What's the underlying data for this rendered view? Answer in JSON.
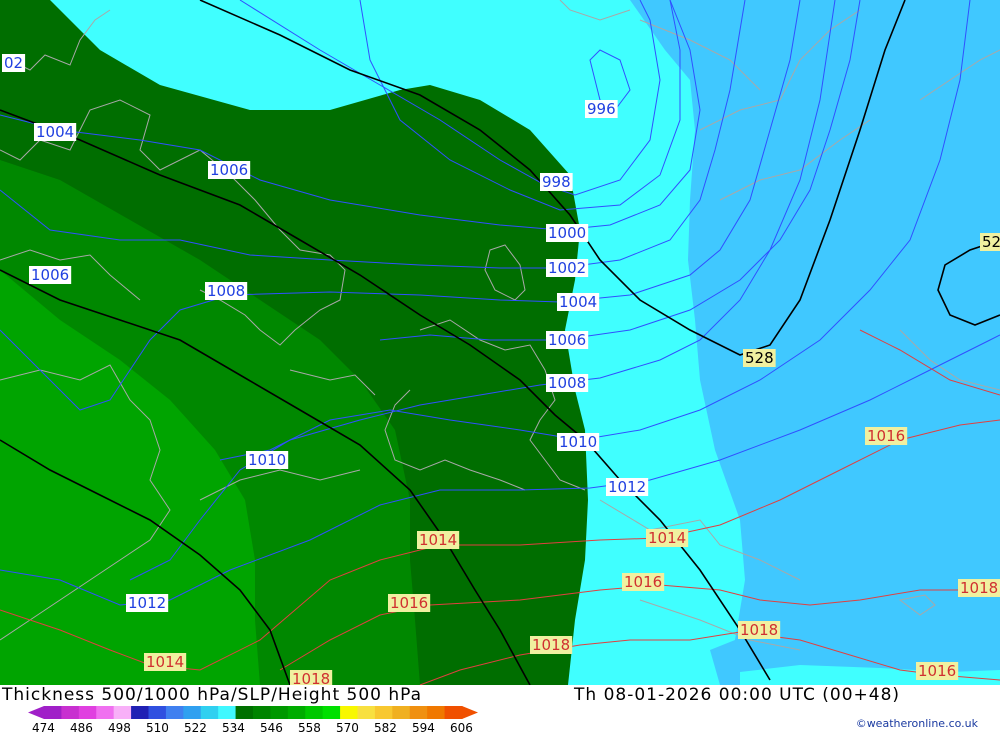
{
  "header": {
    "title": "Thickness 500/1000 hPa/SLP/Height 500 hPa",
    "datetime": "Th 08-01-2026 00:00 UTC (00+48)",
    "credit": "©weatheronline.co.uk"
  },
  "legend": {
    "ticks": [
      "474",
      "486",
      "498",
      "510",
      "522",
      "534",
      "546",
      "558",
      "570",
      "582",
      "594",
      "606"
    ],
    "colors": [
      "#a020c8",
      "#c830d0",
      "#e040e0",
      "#f070f0",
      "#f8b0f8",
      "#2020b4",
      "#3050e0",
      "#4080f0",
      "#30a0f0",
      "#30d0f0",
      "#40f8ff",
      "#007000",
      "#008400",
      "#009800",
      "#00ac00",
      "#00c800",
      "#00e000",
      "#f8f800",
      "#f8e040",
      "#f8c830",
      "#f0b020",
      "#f09010",
      "#f07800",
      "#f05000"
    ]
  },
  "map": {
    "colors": {
      "light_cyan": "#40ffff",
      "sky_blue": "#40c8ff",
      "dark_green": "#006e00",
      "mid_green": "#008800",
      "light_green": "#00a400",
      "bright_green": "#00b400",
      "isobar_blue": "#3050ff",
      "isobar_red": "#e04040",
      "height_black": "#000000",
      "coast_grey": "#a8a8a8"
    },
    "isobar_labels": [
      {
        "id": "slp-1002-edge",
        "text": "02",
        "kind": "blue"
      },
      {
        "id": "slp-1004-west",
        "text": "1004",
        "kind": "blue"
      },
      {
        "id": "slp-1006-north",
        "text": "1006",
        "kind": "blue"
      },
      {
        "id": "slp-1006-west",
        "text": "1006",
        "kind": "blue"
      },
      {
        "id": "slp-1008-west",
        "text": "1008",
        "kind": "blue"
      },
      {
        "id": "slp-1010-west",
        "text": "1010",
        "kind": "blue"
      },
      {
        "id": "slp-1012-west",
        "text": "1012",
        "kind": "blue"
      },
      {
        "id": "slp-1014-west",
        "text": "1014",
        "kind": "red"
      },
      {
        "id": "slp-1018-south",
        "text": "1018",
        "kind": "red"
      },
      {
        "id": "slp-1016-central",
        "text": "1016",
        "kind": "red"
      },
      {
        "id": "slp-1014-central",
        "text": "1014",
        "kind": "red"
      },
      {
        "id": "slp-996",
        "text": "996",
        "kind": "blue"
      },
      {
        "id": "slp-998",
        "text": "998",
        "kind": "blue"
      },
      {
        "id": "slp-1000",
        "text": "1000",
        "kind": "blue"
      },
      {
        "id": "slp-1002",
        "text": "1002",
        "kind": "blue"
      },
      {
        "id": "slp-1004",
        "text": "1004",
        "kind": "blue"
      },
      {
        "id": "slp-1006",
        "text": "1006",
        "kind": "blue"
      },
      {
        "id": "slp-1008",
        "text": "1008",
        "kind": "blue"
      },
      {
        "id": "slp-1010",
        "text": "1010",
        "kind": "blue"
      },
      {
        "id": "slp-1012",
        "text": "1012",
        "kind": "blue"
      },
      {
        "id": "slp-1014-east",
        "text": "1014",
        "kind": "red"
      },
      {
        "id": "slp-1016-east",
        "text": "1016",
        "kind": "red"
      },
      {
        "id": "slp-1018-east",
        "text": "1018",
        "kind": "red"
      },
      {
        "id": "slp-1018-central",
        "text": "1018",
        "kind": "red"
      },
      {
        "id": "slp-1016-far-east",
        "text": "1016",
        "kind": "red"
      },
      {
        "id": "slp-1018-far-east",
        "text": "1018",
        "kind": "red"
      },
      {
        "id": "slp-1016-south-east",
        "text": "1016",
        "kind": "red"
      }
    ],
    "height_labels": [
      {
        "id": "hgt-528",
        "text": "528"
      },
      {
        "id": "hgt-52-edge",
        "text": "52"
      }
    ]
  }
}
